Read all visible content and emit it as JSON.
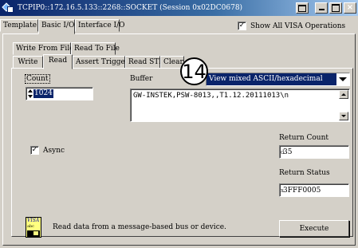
{
  "window": {
    "title": "TCPIP0::172.16.5.133::2268::SOCKET (Session 0x02DC0678)"
  },
  "tabs": [
    "Template",
    "Basic I/O",
    "Interface I/O"
  ],
  "active_tab": "Basic I/O",
  "show_all": {
    "label": "Show All VISA Operations",
    "checked": true
  },
  "operation_tabs_row1": [
    "Write From File",
    "Read To File"
  ],
  "operation_tabs_row2": [
    "Write",
    "Read",
    "Assert Trigger",
    "Read STB",
    "Clear"
  ],
  "active_operation": "Read",
  "count": {
    "label": "Count",
    "value": "1024"
  },
  "buffer": {
    "label": "Buffer",
    "view_mode": "View mixed ASCII/hexadecimal",
    "content": "GW-INSTEK,PSW-8013,,T1.12.20111013\\n"
  },
  "callout": "14",
  "async": {
    "label": "Async",
    "checked": true
  },
  "return_count": {
    "label": "Return Count",
    "value": "35"
  },
  "return_status": {
    "label": "Return Status",
    "value": "3FFF0005"
  },
  "description": "Read data from a message-based bus or device.",
  "visa_icon": {
    "line1": "VISA",
    "line2": "abc"
  },
  "execute_label": "Execute"
}
